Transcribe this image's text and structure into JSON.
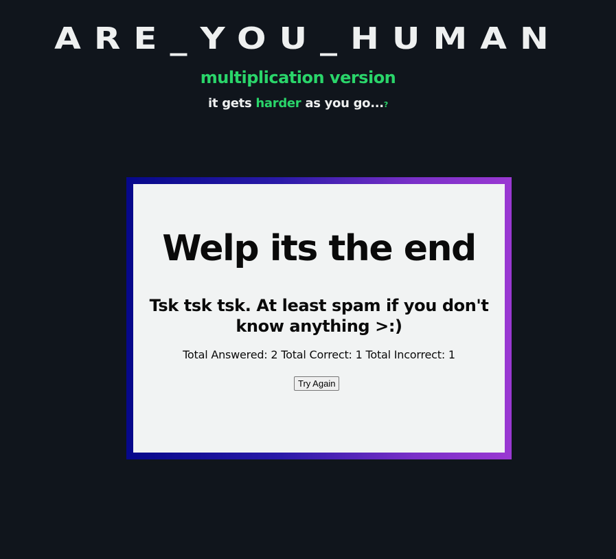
{
  "header": {
    "title": "ARE_YOU_HUMAN",
    "subtitle": "multiplication version",
    "tagline": {
      "part1": "it gets ",
      "highlight": "harder",
      "part2": " as you go...",
      "suffix": "?"
    }
  },
  "result_card": {
    "heading": "Welp its the end",
    "message": "Tsk tsk tsk. At least spam if you don't know anything >:)",
    "stats": {
      "answered_label": "Total Answered:",
      "answered": "2",
      "correct_label": "Total Correct:",
      "correct": "1",
      "incorrect_label": "Total Incorrect:",
      "incorrect": "1"
    },
    "button_label": "Try Again"
  },
  "colors": {
    "background": "#10151c",
    "accent_green": "#2ad56a",
    "frame_gradient_start": "#06088a",
    "frame_gradient_end": "#9a38d2",
    "card_background": "#f1f3f3"
  }
}
